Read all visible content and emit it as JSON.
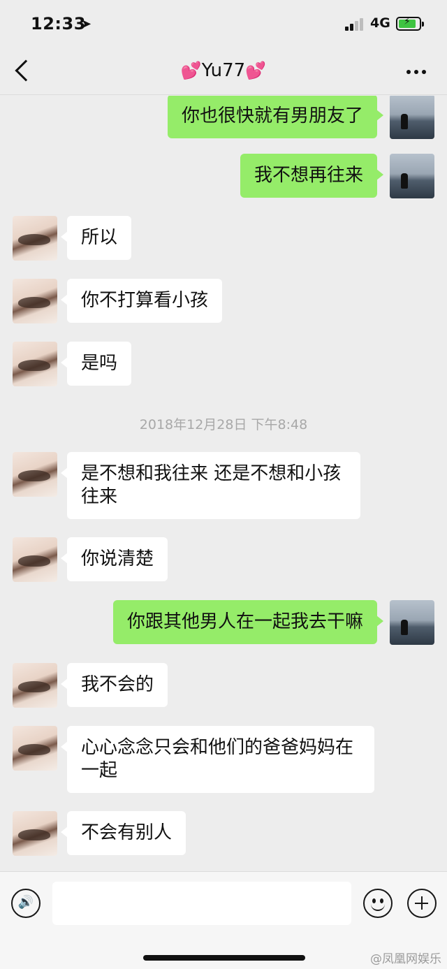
{
  "status_bar": {
    "time": "12:33",
    "network": "4G"
  },
  "nav": {
    "title": "Yu77",
    "heart_left": "💕",
    "heart_right": "💕"
  },
  "messages": [
    {
      "side": "right",
      "text": "你也很快就有男朋友了"
    },
    {
      "side": "right",
      "text": "我不想再往来"
    },
    {
      "side": "left",
      "text": "所以"
    },
    {
      "side": "left",
      "text": "你不打算看小孩"
    },
    {
      "side": "left",
      "text": "是吗"
    },
    {
      "type": "timestamp",
      "text": "2018年12月28日 下午8:48"
    },
    {
      "side": "left",
      "text": "是不想和我往来 还是不想和小孩往来"
    },
    {
      "side": "left",
      "text": "你说清楚"
    },
    {
      "side": "right",
      "text": "你跟其他男人在一起我去干嘛"
    },
    {
      "side": "left",
      "text": "我不会的"
    },
    {
      "side": "left",
      "text": "心心念念只会和他们的爸爸妈妈在一起"
    },
    {
      "side": "left",
      "text": "不会有别人"
    }
  ],
  "input_bar": {
    "placeholder": ""
  },
  "watermark": "@凤凰网娱乐",
  "colors": {
    "sent_bubble": "#95ec69",
    "received_bubble": "#ffffff",
    "background": "#ededed"
  }
}
